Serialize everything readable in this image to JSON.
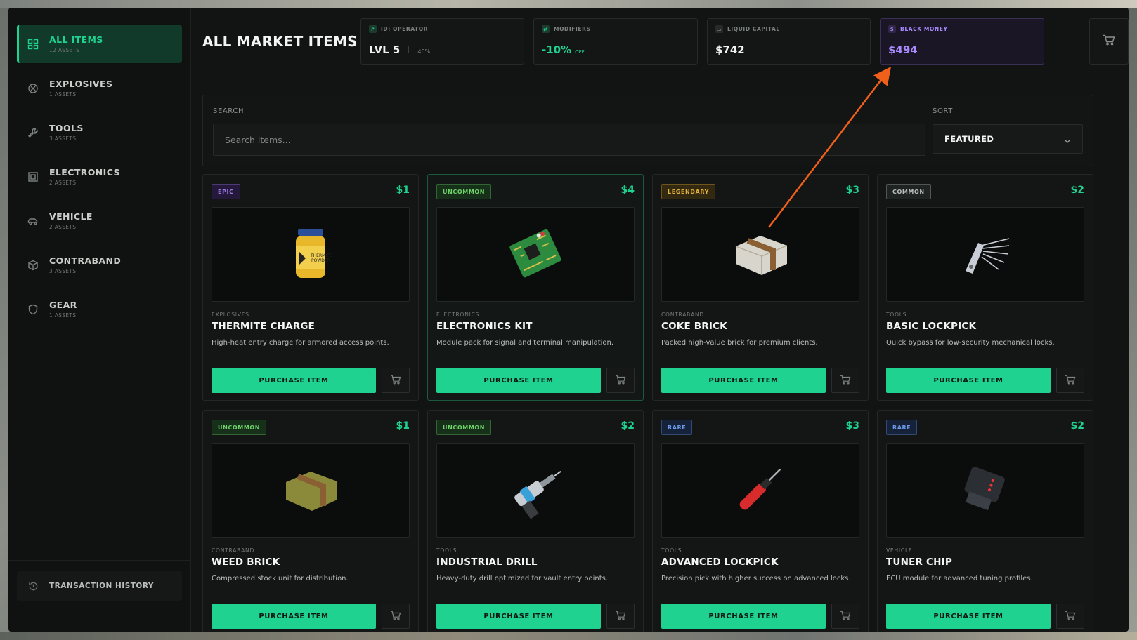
{
  "sidebar": {
    "items": [
      {
        "label": "ALL ITEMS",
        "count": "12 ASSETS",
        "icon": "grid-icon",
        "active": true
      },
      {
        "label": "EXPLOSIVES",
        "count": "1 ASSETS",
        "icon": "explosive-icon"
      },
      {
        "label": "TOOLS",
        "count": "3 ASSETS",
        "icon": "wrench-icon"
      },
      {
        "label": "ELECTRONICS",
        "count": "2 ASSETS",
        "icon": "chip-icon"
      },
      {
        "label": "VEHICLE",
        "count": "2 ASSETS",
        "icon": "car-icon"
      },
      {
        "label": "CONTRABAND",
        "count": "3 ASSETS",
        "icon": "box-icon"
      },
      {
        "label": "GEAR",
        "count": "1 ASSETS",
        "icon": "shield-icon"
      }
    ],
    "footer": {
      "label": "TRANSACTION HISTORY",
      "icon": "history-icon"
    }
  },
  "header": {
    "title": "ALL MARKET ITEMS",
    "stats": {
      "operator": {
        "label": "ID: OPERATOR",
        "level": "LVL 5",
        "progress": "46%"
      },
      "modifiers": {
        "label": "MODIFIERS",
        "value": "-10%",
        "suffix": "OFF"
      },
      "liquid": {
        "label": "LIQUID CAPITAL",
        "value": "$742"
      },
      "black": {
        "label": "BLACK MONEY",
        "value": "$494"
      }
    }
  },
  "search": {
    "label": "SEARCH",
    "placeholder": "Search items...",
    "value": "",
    "sort_label": "SORT",
    "sort_value": "FEATURED"
  },
  "colors": {
    "accent": "#1fd28f",
    "epic": "#a07be6",
    "uncommon": "#6fd36a",
    "legendary": "#e4b23a",
    "common": "#b9bfbc",
    "rare": "#6b9ae6",
    "black_money": "#a98bff",
    "annotation_arrow": "#f0601a"
  },
  "buy_label": "PURCHASE ITEM",
  "items": [
    {
      "rarity": "EPIC",
      "price": "$1",
      "category": "EXPLOSIVES",
      "name": "THERMITE CHARGE",
      "desc": "High-heat entry charge for armored access points.",
      "icon": "jar-icon"
    },
    {
      "rarity": "UNCOMMON",
      "price": "$4",
      "category": "ELECTRONICS",
      "name": "ELECTRONICS KIT",
      "desc": "Module pack for signal and terminal manipulation.",
      "icon": "circuit-board-icon"
    },
    {
      "rarity": "LEGENDARY",
      "price": "$3",
      "category": "CONTRABAND",
      "name": "COKE BRICK",
      "desc": "Packed high-value brick for premium clients.",
      "icon": "brick-icon"
    },
    {
      "rarity": "COMMON",
      "price": "$2",
      "category": "TOOLS",
      "name": "BASIC LOCKPICK",
      "desc": "Quick bypass for low-security mechanical locks.",
      "icon": "lockpick-icon"
    },
    {
      "rarity": "UNCOMMON",
      "price": "$1",
      "category": "CONTRABAND",
      "name": "WEED BRICK",
      "desc": "Compressed stock unit for distribution.",
      "icon": "brick-icon"
    },
    {
      "rarity": "UNCOMMON",
      "price": "$2",
      "category": "TOOLS",
      "name": "INDUSTRIAL DRILL",
      "desc": "Heavy-duty drill optimized for vault entry points.",
      "icon": "drill-icon"
    },
    {
      "rarity": "RARE",
      "price": "$3",
      "category": "TOOLS",
      "name": "ADVANCED LOCKPICK",
      "desc": "Precision pick with higher success on advanced locks.",
      "icon": "screwdriver-icon"
    },
    {
      "rarity": "RARE",
      "price": "$2",
      "category": "VEHICLE",
      "name": "TUNER CHIP",
      "desc": "ECU module for advanced tuning profiles.",
      "icon": "tuner-chip-icon"
    }
  ]
}
